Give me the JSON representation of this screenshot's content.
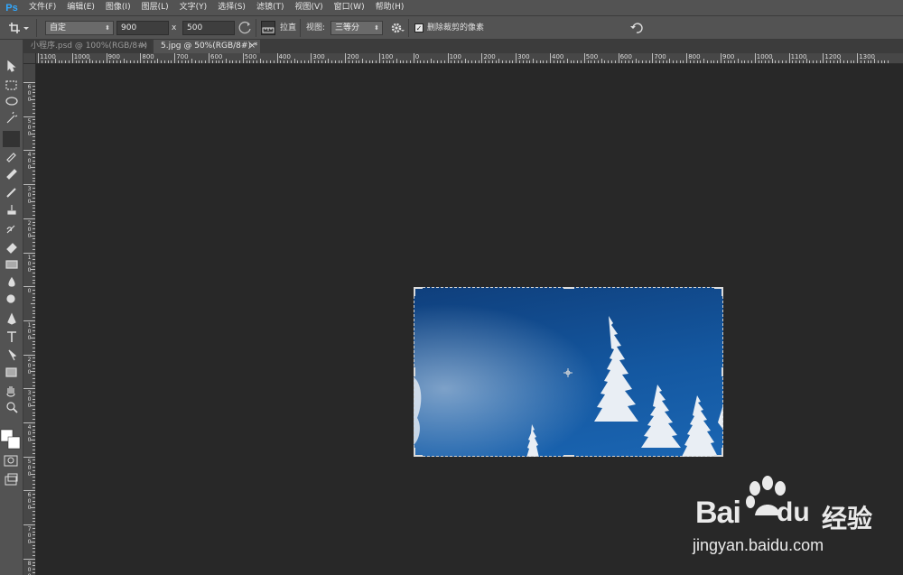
{
  "app_logo": "Ps",
  "menu": [
    "文件(F)",
    "编辑(E)",
    "图像(I)",
    "图层(L)",
    "文字(Y)",
    "选择(S)",
    "滤镜(T)",
    "视图(V)",
    "窗口(W)",
    "帮助(H)"
  ],
  "options": {
    "ratio_preset": "自定",
    "width": "900",
    "times": "x",
    "height": "500",
    "straighten_label": "拉直",
    "view_label": "视图:",
    "view_value": "三等分",
    "delete_cropped_label": "删除裁剪的像素",
    "delete_cropped_checked": true
  },
  "tabs": [
    {
      "label": "小程序.psd @ 100%(RGB/8#)",
      "close": "×",
      "active": false
    },
    {
      "label": "5.jpg @ 50%(RGB/8#) *",
      "close": "×",
      "active": true
    }
  ],
  "ruler_h": [
    "1100",
    "1000",
    "900",
    "800",
    "700",
    "600",
    "500",
    "400",
    "300",
    "200",
    "100",
    "0",
    "100",
    "200",
    "300",
    "400",
    "500",
    "600",
    "700",
    "800",
    "900",
    "1000",
    "1100",
    "1200",
    "1300"
  ],
  "ruler_v": [
    "6",
    "5",
    "4",
    "3",
    "2",
    "1",
    "0",
    "1",
    "2",
    "3",
    "4",
    "5",
    "6",
    "7",
    "8"
  ],
  "watermark": {
    "brand": "Bai",
    "brand2": "du",
    "cn": "经验",
    "url": "jingyan.baidu.com"
  },
  "colors": {
    "ps_blue": "#31a8ff",
    "sky": "#1458a1",
    "ui_bg": "#535353",
    "canvas": "#282828"
  },
  "icons": {
    "tools": [
      "move-icon",
      "marquee-icon",
      "lasso-icon",
      "quick-select-icon",
      "crop-icon",
      "eyedropper-icon",
      "healing-brush-icon",
      "brush-icon",
      "clone-stamp-icon",
      "history-brush-icon",
      "eraser-icon",
      "gradient-icon",
      "blur-icon",
      "dodge-icon",
      "pen-icon",
      "type-icon",
      "path-select-icon",
      "rectangle-icon",
      "hand-icon",
      "zoom-icon"
    ]
  }
}
